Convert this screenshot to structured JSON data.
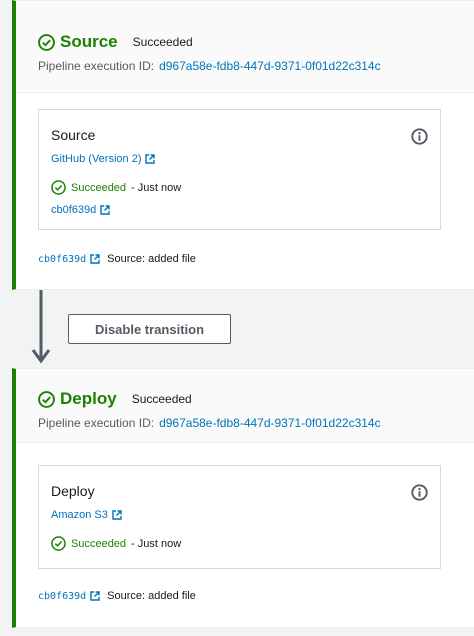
{
  "stages": [
    {
      "name": "Source",
      "status": "Succeeded",
      "execution_label": "Pipeline execution ID:",
      "execution_id": "d967a58e-fdb8-447d-9371-0f01d22c314c",
      "action": {
        "name": "Source",
        "provider": "GitHub (Version 2)",
        "status": "Succeeded",
        "time": "- Just now",
        "commit": "cb0f639d"
      },
      "footer": {
        "commit": "cb0f639d",
        "message": "Source: added file"
      }
    },
    {
      "name": "Deploy",
      "status": "Succeeded",
      "execution_label": "Pipeline execution ID:",
      "execution_id": "d967a58e-fdb8-447d-9371-0f01d22c314c",
      "action": {
        "name": "Deploy",
        "provider": "Amazon S3",
        "status": "Succeeded",
        "time": "- Just now"
      },
      "footer": {
        "commit": "cb0f639d",
        "message": "Source: added file"
      }
    }
  ],
  "transition": {
    "button_label": "Disable transition"
  },
  "colors": {
    "success": "#1d8102",
    "link": "#0073bb",
    "text": "#16191f",
    "muted": "#545b64"
  },
  "icons": {
    "stage_status": "check-circle-icon",
    "info": "info-icon",
    "external_link": "external-link-icon",
    "arrow": "arrow-down-icon"
  }
}
